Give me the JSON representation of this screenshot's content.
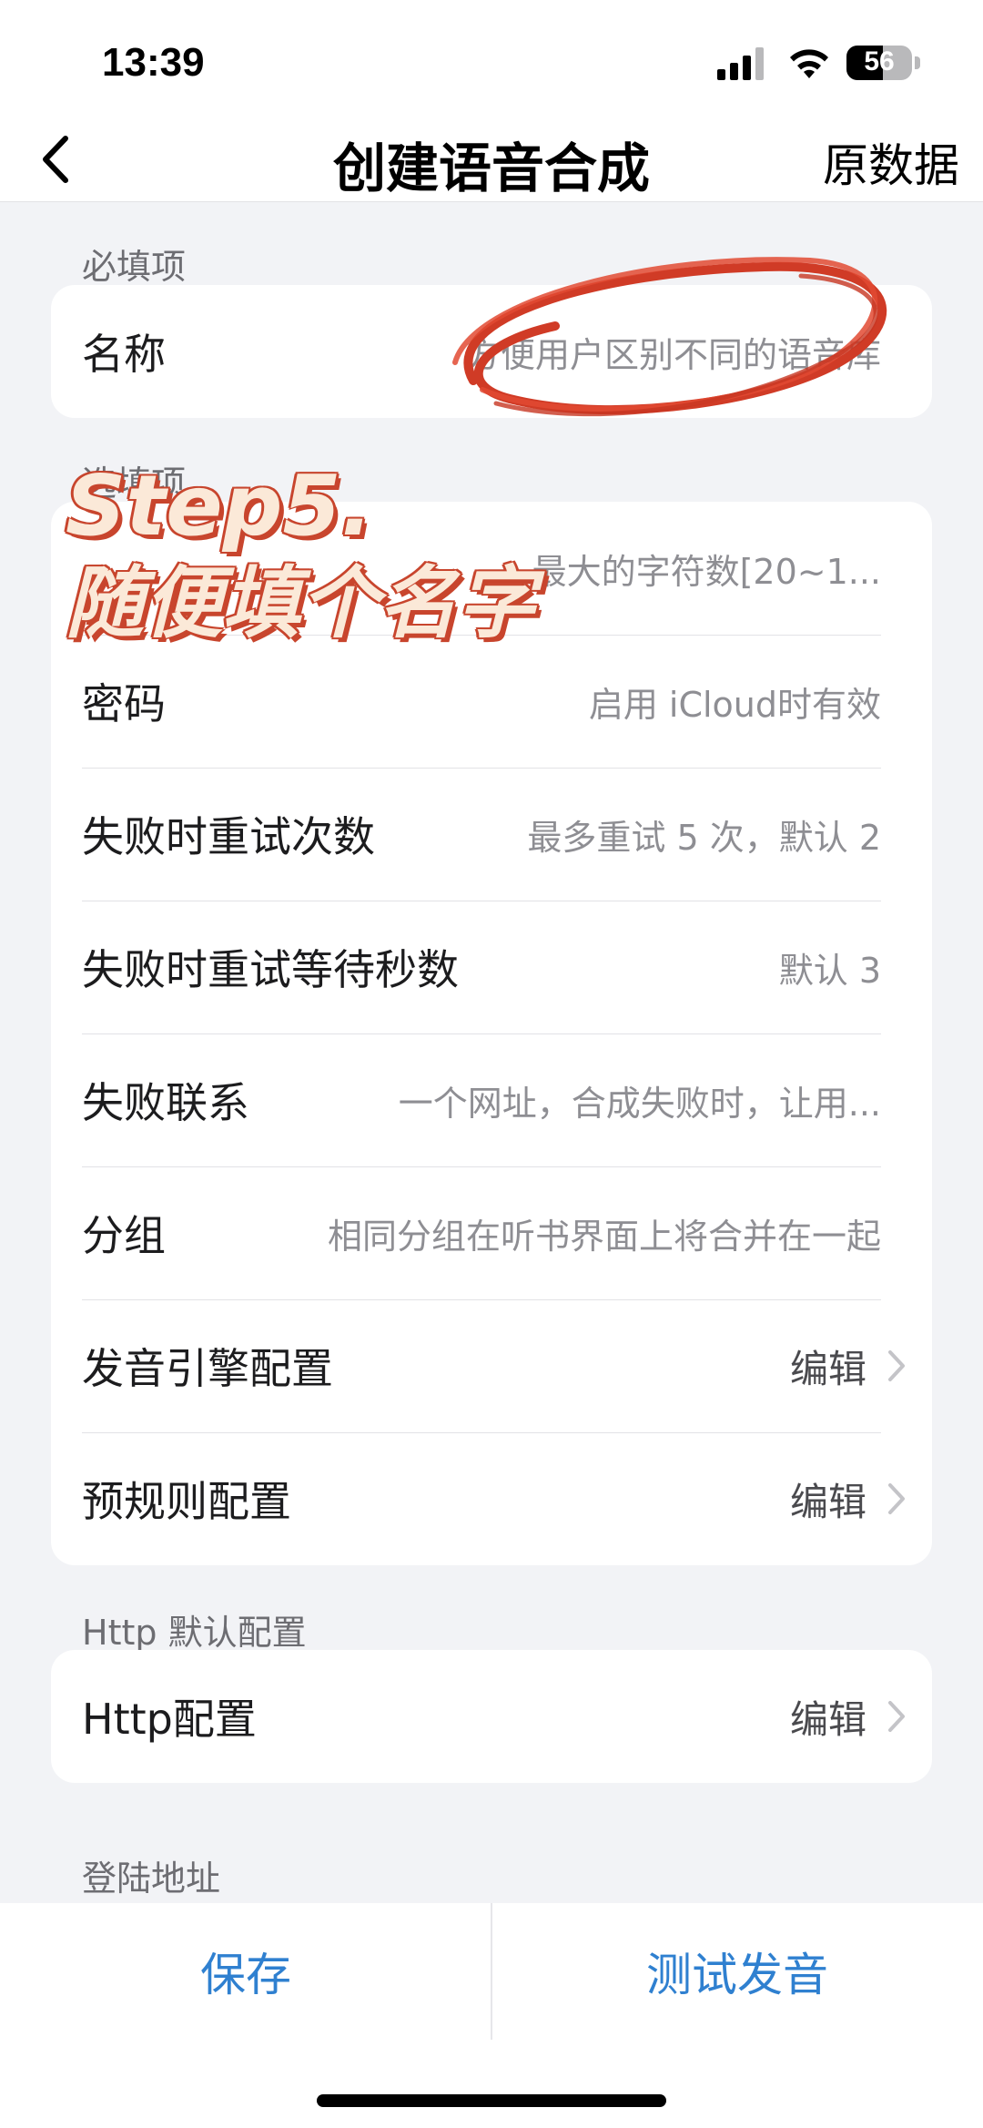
{
  "status_bar": {
    "time": "13:39",
    "battery_level": "56",
    "battery_fraction": 0.56
  },
  "nav": {
    "title": "创建语音合成",
    "right_action": "原数据",
    "back_icon": "chevron-left-icon"
  },
  "required_section": {
    "header": "必填项",
    "name_row": {
      "label": "名称",
      "placeholder": "方便用户区别不同的语音库"
    }
  },
  "optional_section": {
    "header": "选填项",
    "rows": [
      {
        "label": "",
        "value": "最大的字符数[20~1..."
      },
      {
        "label": "密码",
        "value": "启用 iCloud时有效"
      },
      {
        "label": "失败时重试次数",
        "value": "最多重试 5 次，默认 2"
      },
      {
        "label": "失败时重试等待秒数",
        "value": "默认 3"
      },
      {
        "label": "失败联系",
        "value": "一个网址，合成失败时，让用..."
      },
      {
        "label": "分组",
        "value": "相同分组在听书界面上将合并在一起"
      }
    ],
    "edit_rows": [
      {
        "label": "发音引擎配置",
        "action": "编辑"
      },
      {
        "label": "预规则配置",
        "action": "编辑"
      }
    ]
  },
  "http_section": {
    "header": "Http 默认配置",
    "row": {
      "label": "Http配置",
      "action": "编辑"
    }
  },
  "login_section": {
    "header": "登陆地址"
  },
  "bottom_bar": {
    "save": "保存",
    "test": "测试发音"
  },
  "overlay": {
    "line1": "Step5.",
    "line2": "随便填个名字",
    "accent_color": "#d03b26"
  },
  "colors": {
    "link_blue": "#2f80d0",
    "background": "#f2f3f6"
  }
}
